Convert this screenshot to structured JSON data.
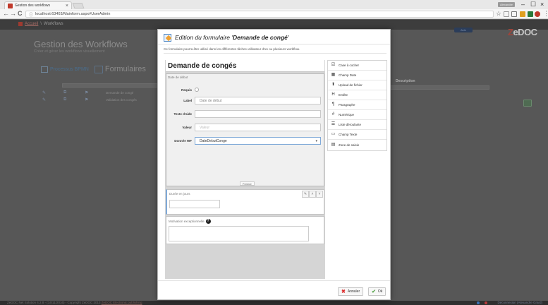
{
  "browser": {
    "tab_title": "Gestion des workflows",
    "tab_close": "×",
    "profile_label": "Alexandre",
    "minimize": "–",
    "maximize": "☐",
    "close": "×",
    "back": "←",
    "forward": "→",
    "reload": "C",
    "info_icon": "ⓘ",
    "url": "localhost:63403/Mainform.aspx#UserAdmin",
    "star": "☆"
  },
  "app": {
    "breadcrumb_home": "Accueil",
    "breadcrumb_sep": "\\",
    "breadcrumb_current": "Workflows",
    "title": "Gestion des Workflows",
    "subtitle": "Créer et gérer les workflows visuellement",
    "help_label": "Aide",
    "logo_z": "Z",
    "logo_rest": "eDOC",
    "tab_bpmn": "Processus BPMN",
    "tab_forms": "Formulaires",
    "description_header": "Description",
    "rows": [
      {
        "name": "Demande de congé"
      },
      {
        "name": "Validation des congés"
      }
    ]
  },
  "modal": {
    "title_prefix": "Edition du formulaire '",
    "title_form": "Demande de congé",
    "title_suffix": "'",
    "description": "Ce formulaire pourra être utilisé dans les différentes tâches utilisateur d'un ou plusieurs workflow.",
    "form_title": "Demande de congés",
    "field1": {
      "name": "Date de début",
      "requis_label": "Requis",
      "label_label": "Label",
      "label_value": "Date de début",
      "aide_label": "Texte d'aide",
      "aide_value": "",
      "valeur_label": "Valeur",
      "valeur_placeholder": "Valeur",
      "donnee_label": "Donnée WF",
      "donnee_value": "DateDebutConge",
      "fermer": "Fermer"
    },
    "field2": {
      "name": "Durée en jours",
      "ctrl_edit": "✎",
      "ctrl_up": "˄",
      "ctrl_down": "˅"
    },
    "field3": {
      "name": "Motivation exceptionnelle",
      "help": "?"
    },
    "palette": [
      {
        "icon": "☑",
        "label": "Case à cocher"
      },
      {
        "icon": "▦",
        "label": "Champ Date"
      },
      {
        "icon": "⬆",
        "label": "Upload de fichier"
      },
      {
        "icon": "H",
        "label": "Entête"
      },
      {
        "icon": "¶",
        "label": "Paragraphe"
      },
      {
        "icon": "#",
        "label": "Numérique"
      },
      {
        "icon": "☰",
        "label": "Liste déroulante"
      },
      {
        "icon": "▭",
        "label": "Champ Texte"
      },
      {
        "icon": "▤",
        "label": "Zone de saisie"
      }
    ],
    "cancel_icon": "✖",
    "cancel": "Annuler",
    "ok_icon": "✔",
    "ok": "Ok"
  },
  "footer": {
    "text": "ZeDOC Net Solution 4.2.8 - (14/11/2016) - Copyright ZeDOC 2013",
    "link": "ZeDOC Electronic publishing",
    "user": "Déconnexion (Alexandre Grard)"
  }
}
